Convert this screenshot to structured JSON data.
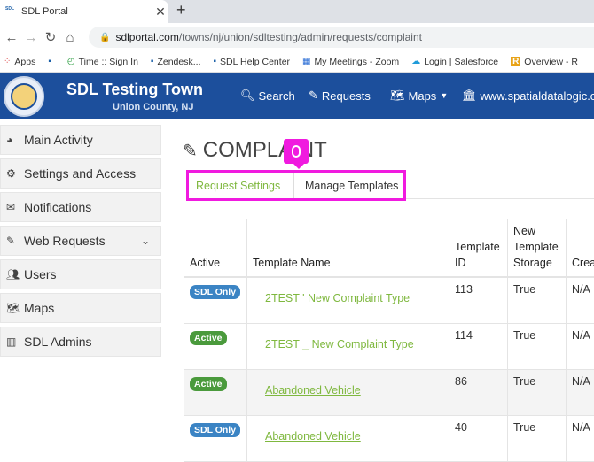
{
  "browser": {
    "tab_title": "SDL Portal",
    "tab_favicon_text": "SDL",
    "tab_close": "✕",
    "new_tab": "+",
    "url_host": "sdlportal.com",
    "url_path": "/towns/nj/union/sdltesting/admin/requests/complaint",
    "bookmarks": [
      {
        "icon": "apps-grid-icon",
        "glyph": "⁘",
        "label": "Apps"
      },
      {
        "icon": "sdl-favicon-icon",
        "glyph": "▪",
        "label": ""
      },
      {
        "icon": "clock-icon",
        "glyph": "◴",
        "label": "Time :: Sign In"
      },
      {
        "icon": "sdl-favicon-icon",
        "glyph": "▪",
        "label": "Zendesk..."
      },
      {
        "icon": "sdl-favicon-icon",
        "glyph": "▪",
        "label": "SDL Help Center"
      },
      {
        "icon": "calendar-icon",
        "glyph": "▦",
        "label": "My Meetings - Zoom"
      },
      {
        "icon": "cloud-icon",
        "glyph": "☁",
        "label": "Login | Salesforce"
      },
      {
        "icon": "r-logo-icon",
        "glyph": "R",
        "label": "Overview - R"
      }
    ]
  },
  "site": {
    "name": "SDL Testing Town",
    "county": "Union County, NJ",
    "nav": {
      "search": "Search",
      "requests": "Requests",
      "maps": "Maps",
      "external": "www.spatialdatalogic.com"
    }
  },
  "sidebar": {
    "items": [
      {
        "label": "Main Activity"
      },
      {
        "label": "Settings and Access"
      },
      {
        "label": "Notifications"
      },
      {
        "label": "Web Requests"
      },
      {
        "label": "Users"
      },
      {
        "label": "Maps"
      },
      {
        "label": "SDL Admins"
      }
    ]
  },
  "main": {
    "title": "COMPLAINT",
    "tabs": [
      {
        "label": "Request Settings"
      },
      {
        "label": "Manage Templates"
      }
    ],
    "table": {
      "headers": [
        "Active",
        "Template Name",
        "Template ID",
        "New Template Storage",
        "Created On"
      ],
      "rows": [
        {
          "badge": "SDL Only",
          "name": "2TEST ' New Complaint Type",
          "id": "113",
          "storage": "True",
          "created": "N/A"
        },
        {
          "badge": "Active",
          "name": "2TEST _ New Complaint Type",
          "id": "114",
          "storage": "True",
          "created": "N/A"
        },
        {
          "badge": "Active",
          "name": "Abandoned Vehicle",
          "id": "86",
          "storage": "True",
          "created": "N/A"
        },
        {
          "badge": "SDL Only",
          "name": "Abandoned Vehicle",
          "id": "40",
          "storage": "True",
          "created": "N/A"
        }
      ]
    }
  },
  "colors": {
    "header_blue": "#1c4f9c",
    "highlight_magenta": "#f01adf",
    "link_green": "#7fb83f",
    "badge_blue": "#3b84c4",
    "badge_green": "#4a9a3c"
  }
}
